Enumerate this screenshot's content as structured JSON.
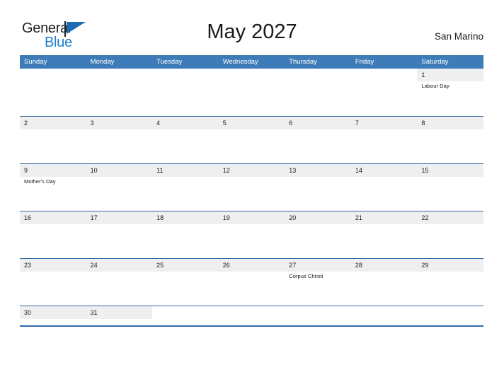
{
  "brand": {
    "name_part1": "General",
    "name_part2": "Blue",
    "flag_icon": "flag-triangle-icon"
  },
  "header": {
    "title": "May 2027",
    "location": "San Marino"
  },
  "calendar": {
    "month": "May",
    "year": "2027",
    "weekday_headers": [
      "Sunday",
      "Monday",
      "Tuesday",
      "Wednesday",
      "Thursday",
      "Friday",
      "Saturday"
    ],
    "colors": {
      "header_blue": "#3d7cb8",
      "rule_blue": "#2f6ca8",
      "date_band_gray": "#efefef",
      "logo_blue": "#1b7fd1",
      "text_dark": "#1a1a1a"
    },
    "weeks": [
      {
        "days": [
          {
            "date": "",
            "events": []
          },
          {
            "date": "",
            "events": []
          },
          {
            "date": "",
            "events": []
          },
          {
            "date": "",
            "events": []
          },
          {
            "date": "",
            "events": []
          },
          {
            "date": "",
            "events": []
          },
          {
            "date": "1",
            "events": [
              "Labour Day"
            ]
          }
        ]
      },
      {
        "days": [
          {
            "date": "2",
            "events": []
          },
          {
            "date": "3",
            "events": []
          },
          {
            "date": "4",
            "events": []
          },
          {
            "date": "5",
            "events": []
          },
          {
            "date": "6",
            "events": []
          },
          {
            "date": "7",
            "events": []
          },
          {
            "date": "8",
            "events": []
          }
        ]
      },
      {
        "days": [
          {
            "date": "9",
            "events": [
              "Mother's Day"
            ]
          },
          {
            "date": "10",
            "events": []
          },
          {
            "date": "11",
            "events": []
          },
          {
            "date": "12",
            "events": []
          },
          {
            "date": "13",
            "events": []
          },
          {
            "date": "14",
            "events": []
          },
          {
            "date": "15",
            "events": []
          }
        ]
      },
      {
        "days": [
          {
            "date": "16",
            "events": []
          },
          {
            "date": "17",
            "events": []
          },
          {
            "date": "18",
            "events": []
          },
          {
            "date": "19",
            "events": []
          },
          {
            "date": "20",
            "events": []
          },
          {
            "date": "21",
            "events": []
          },
          {
            "date": "22",
            "events": []
          }
        ]
      },
      {
        "days": [
          {
            "date": "23",
            "events": []
          },
          {
            "date": "24",
            "events": []
          },
          {
            "date": "25",
            "events": []
          },
          {
            "date": "26",
            "events": []
          },
          {
            "date": "27",
            "events": [
              "Corpus Christi"
            ]
          },
          {
            "date": "28",
            "events": []
          },
          {
            "date": "29",
            "events": []
          }
        ]
      },
      {
        "days": [
          {
            "date": "30",
            "events": []
          },
          {
            "date": "31",
            "events": []
          },
          {
            "date": "",
            "events": []
          },
          {
            "date": "",
            "events": []
          },
          {
            "date": "",
            "events": []
          },
          {
            "date": "",
            "events": []
          },
          {
            "date": "",
            "events": []
          }
        ]
      }
    ]
  }
}
